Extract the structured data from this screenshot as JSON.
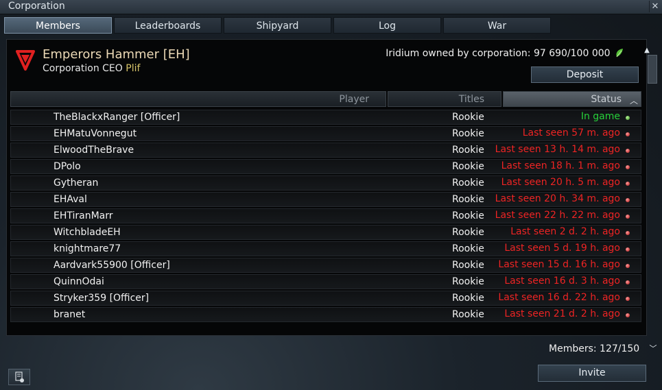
{
  "window": {
    "title": "Corporation"
  },
  "tabs": [
    {
      "label": "Members",
      "active": true
    },
    {
      "label": "Leaderboards",
      "active": false
    },
    {
      "label": "Shipyard",
      "active": false
    },
    {
      "label": "Log",
      "active": false
    },
    {
      "label": "War",
      "active": false
    }
  ],
  "corporation": {
    "name": "Emperors Hammer [EH]",
    "ceo_label": "Corporation CEO",
    "ceo_name": "Plif",
    "iridium_text": "Iridium owned by corporation: 97 690/100 000",
    "deposit_label": "Deposit"
  },
  "table": {
    "headers": {
      "player": "Player",
      "titles": "Titles",
      "status": "Status"
    },
    "rows": [
      {
        "player": "TheBlackxRanger [Officer]",
        "title": "Rookie",
        "status": "In game",
        "online": true
      },
      {
        "player": "EHMatuVonnegut",
        "title": "Rookie",
        "status": "Last seen 57 m. ago",
        "online": false
      },
      {
        "player": "ElwoodTheBrave",
        "title": "Rookie",
        "status": "Last seen 13 h. 14 m. ago",
        "online": false
      },
      {
        "player": "DPolo",
        "title": "Rookie",
        "status": "Last seen 18 h. 1 m. ago",
        "online": false
      },
      {
        "player": "Gytheran",
        "title": "Rookie",
        "status": "Last seen 20 h. 5 m. ago",
        "online": false
      },
      {
        "player": "EHAval",
        "title": "Rookie",
        "status": "Last seen 20 h. 34 m. ago",
        "online": false
      },
      {
        "player": "EHTiranMarr",
        "title": "Rookie",
        "status": "Last seen 22 h. 22 m. ago",
        "online": false
      },
      {
        "player": "WitchbladeEH",
        "title": "Rookie",
        "status": "Last seen 2 d. 2 h. ago",
        "online": false
      },
      {
        "player": "knightmare77",
        "title": "Rookie",
        "status": "Last seen 5 d. 19 h. ago",
        "online": false
      },
      {
        "player": "Aardvark55900 [Officer]",
        "title": "Rookie",
        "status": "Last seen 15 d. 16 h. ago",
        "online": false
      },
      {
        "player": "QuinnOdai",
        "title": "Rookie",
        "status": "Last seen 16 d. 3 h. ago",
        "online": false
      },
      {
        "player": "Stryker359 [Officer]",
        "title": "Rookie",
        "status": "Last seen 16 d. 22 h. ago",
        "online": false
      },
      {
        "player": "branet",
        "title": "Rookie",
        "status": "Last seen 21 d. 2 h. ago",
        "online": false
      }
    ]
  },
  "footer": {
    "members_text": "Members: 127/150",
    "invite_label": "Invite"
  },
  "colors": {
    "online": "#27d13a",
    "offline": "#ee2424",
    "corp_name": "#ecd9b6",
    "ceo_name": "#d8c56a",
    "logo": "#e02020"
  },
  "icons": {
    "close": "close-icon",
    "logo": "corporation-logo-icon",
    "iridium": "iridium-icon",
    "sort": "sort-ascending-icon",
    "status_dot": "status-dot-icon",
    "document": "document-icon"
  }
}
